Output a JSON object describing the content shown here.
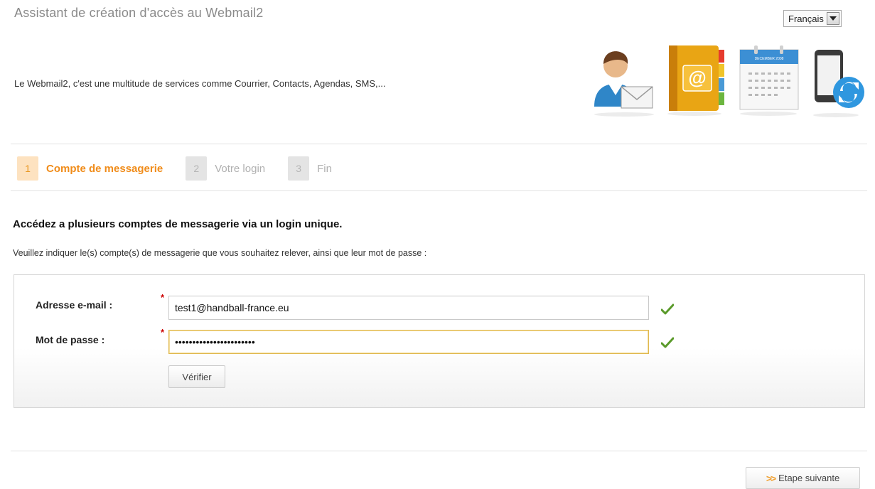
{
  "header": {
    "title": "Assistant de création d'accès au Webmail2",
    "language": "Français",
    "intro": "Le Webmail2, c'est une multitude de services comme Courrier, Contacts, Agendas, SMS,...",
    "service_icons": [
      "user-mail-icon",
      "address-book-icon",
      "calendar-icon",
      "mobile-sync-icon"
    ],
    "calendar_month": "DECEMBER 2008"
  },
  "steps": [
    {
      "number": "1",
      "label": "Compte de messagerie",
      "state": "active"
    },
    {
      "number": "2",
      "label": "Votre login",
      "state": "inactive"
    },
    {
      "number": "3",
      "label": "Fin",
      "state": "inactive"
    }
  ],
  "main": {
    "heading": "Accédez a plusieurs comptes de messagerie via un login unique.",
    "instructions": "Veuillez indiquer le(s) compte(s) de messagerie que vous souhaitez relever, ainsi que leur mot de passe :"
  },
  "form": {
    "email_label": "Adresse e-mail :",
    "email_value": "test1@handball-france.eu",
    "password_label": "Mot de passe :",
    "password_value": "aaaaaaaaaaaaaaaaaaaaaaa",
    "required_marker": "*",
    "verify_label": "Vérifier"
  },
  "footer": {
    "next_label": "Etape suivante"
  },
  "colors": {
    "accent": "#f08c1a",
    "required": "#cc0000",
    "valid": "#5a9a2a"
  }
}
